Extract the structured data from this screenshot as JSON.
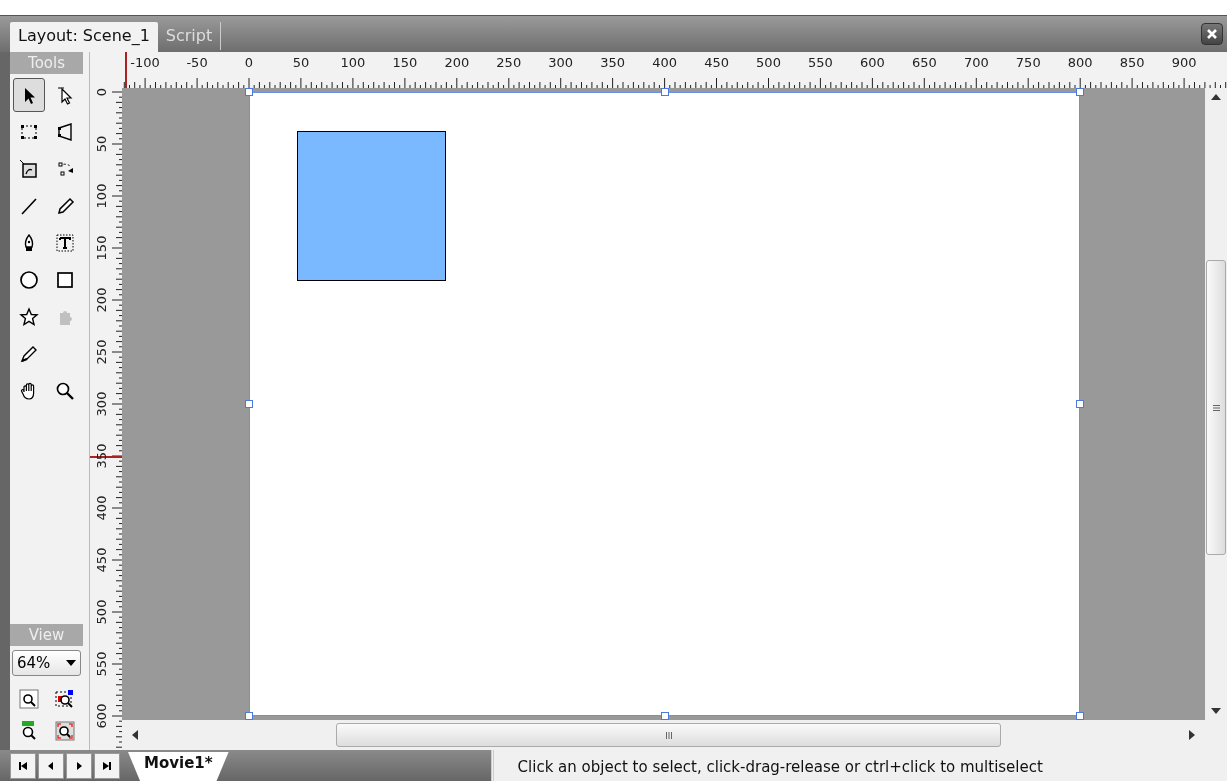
{
  "tabs": [
    {
      "label": "Layout: Scene_1",
      "selected": true
    },
    {
      "label": "Script",
      "selected": false
    }
  ],
  "toolbox": {
    "title": "Tools",
    "tools": [
      {
        "selected": true,
        "disabled": false
      },
      {
        "selected": false,
        "disabled": false
      },
      {
        "selected": false,
        "disabled": false
      },
      {
        "selected": false,
        "disabled": false
      },
      {
        "selected": false,
        "disabled": false
      },
      {
        "selected": false,
        "disabled": false
      },
      {
        "selected": false,
        "disabled": false
      },
      {
        "selected": false,
        "disabled": false
      },
      {
        "selected": false,
        "disabled": false
      },
      {
        "selected": false,
        "disabled": false
      },
      {
        "selected": false,
        "disabled": false
      },
      {
        "selected": false,
        "disabled": false
      },
      {
        "selected": false,
        "disabled": false
      },
      {
        "selected": false,
        "disabled": true
      },
      {
        "selected": false,
        "disabled": false
      },
      {
        "selected": false,
        "disabled": false
      },
      {
        "selected": false,
        "disabled": false
      }
    ]
  },
  "view": {
    "title": "View",
    "zoom": "64%"
  },
  "rulers": {
    "horizontal": [
      "-100",
      "-50",
      "0",
      "50",
      "100",
      "150",
      "200",
      "250",
      "300",
      "350",
      "400",
      "450",
      "500",
      "550",
      "600",
      "650",
      "700",
      "750",
      "800",
      "850",
      "900"
    ],
    "vertical": [
      "0",
      "50",
      "100",
      "150",
      "200",
      "250",
      "300",
      "350",
      "400",
      "450",
      "500",
      "550",
      "600"
    ]
  },
  "stage": {
    "shapes": [
      {
        "kind": "rectangle"
      }
    ]
  },
  "document_tabs": [
    {
      "label": "Movie1*"
    }
  ],
  "status_bar": "Click an object to select, click-drag-release or ctrl+click to multiselect"
}
